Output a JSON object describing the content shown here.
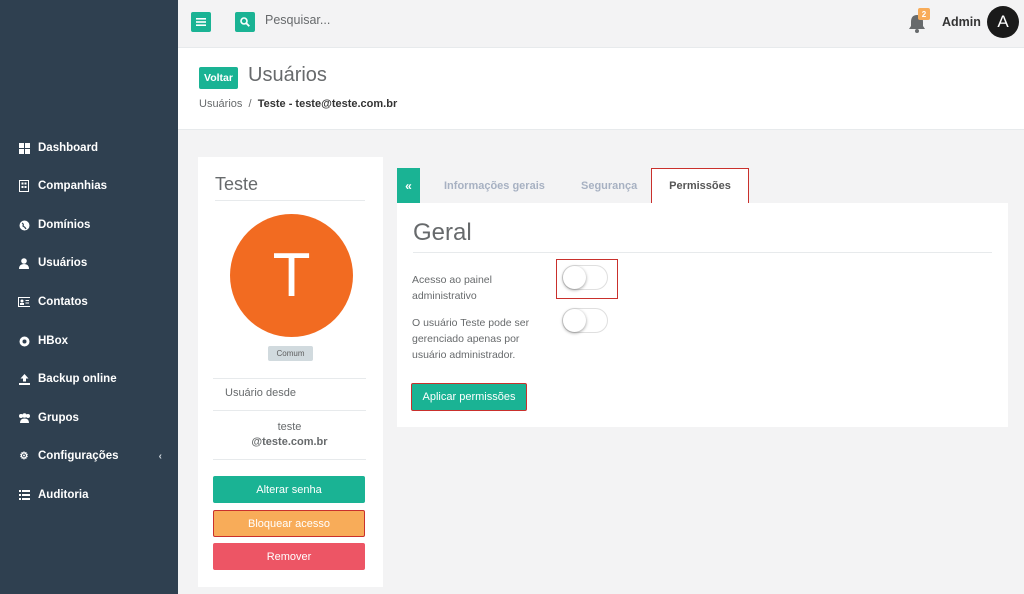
{
  "sidebar": {
    "items": [
      {
        "label": "Dashboard",
        "icon": "th-large-icon"
      },
      {
        "label": "Companhias",
        "icon": "building-icon"
      },
      {
        "label": "Domínios",
        "icon": "globe-icon"
      },
      {
        "label": "Usuários",
        "icon": "user-icon"
      },
      {
        "label": "Contatos",
        "icon": "address-card-icon"
      },
      {
        "label": "HBox",
        "icon": "hbox-icon"
      },
      {
        "label": "Backup online",
        "icon": "cloud-upload-icon"
      },
      {
        "label": "Grupos",
        "icon": "users-icon"
      },
      {
        "label": "Configurações",
        "icon": "gear-icon"
      },
      {
        "label": "Auditoria",
        "icon": "list-icon"
      }
    ]
  },
  "topbar": {
    "search_placeholder": "Pesquisar...",
    "notifications_count": "2",
    "user_name": "Admin",
    "user_initial": "A"
  },
  "header": {
    "back_label": "Voltar",
    "title": "Usuários",
    "breadcrumb": {
      "parent": "Usuários",
      "separator": "/",
      "current": "Teste - teste@teste.com.br"
    }
  },
  "profile": {
    "name": "Teste",
    "initial": "T",
    "role": "Comum",
    "since_label": "Usuário desde",
    "email_user": "teste",
    "email_domain": "@teste.com.br",
    "buttons": {
      "change_password": "Alterar senha",
      "block_access": "Bloquear acesso",
      "remove": "Remover"
    }
  },
  "tabs": {
    "toggle_icon": "«",
    "items": [
      "Informações gerais",
      "Segurança",
      "Permissões"
    ],
    "active": "Permissões"
  },
  "permissions": {
    "section_title": "Geral",
    "admin_panel_label": "Acesso ao painel administrativo",
    "admin_panel_enabled": false,
    "managed_label": "O usuário Teste pode ser gerenciado apenas por usuário administrador.",
    "managed_enabled": false,
    "apply_label": "Aplicar permissões"
  },
  "colors": {
    "primary": "#1ab394",
    "sidebar": "#2f4050",
    "warning": "#f8ac59",
    "danger": "#ed5565",
    "avatar": "#f26b21",
    "highlight": "#c9302c"
  }
}
